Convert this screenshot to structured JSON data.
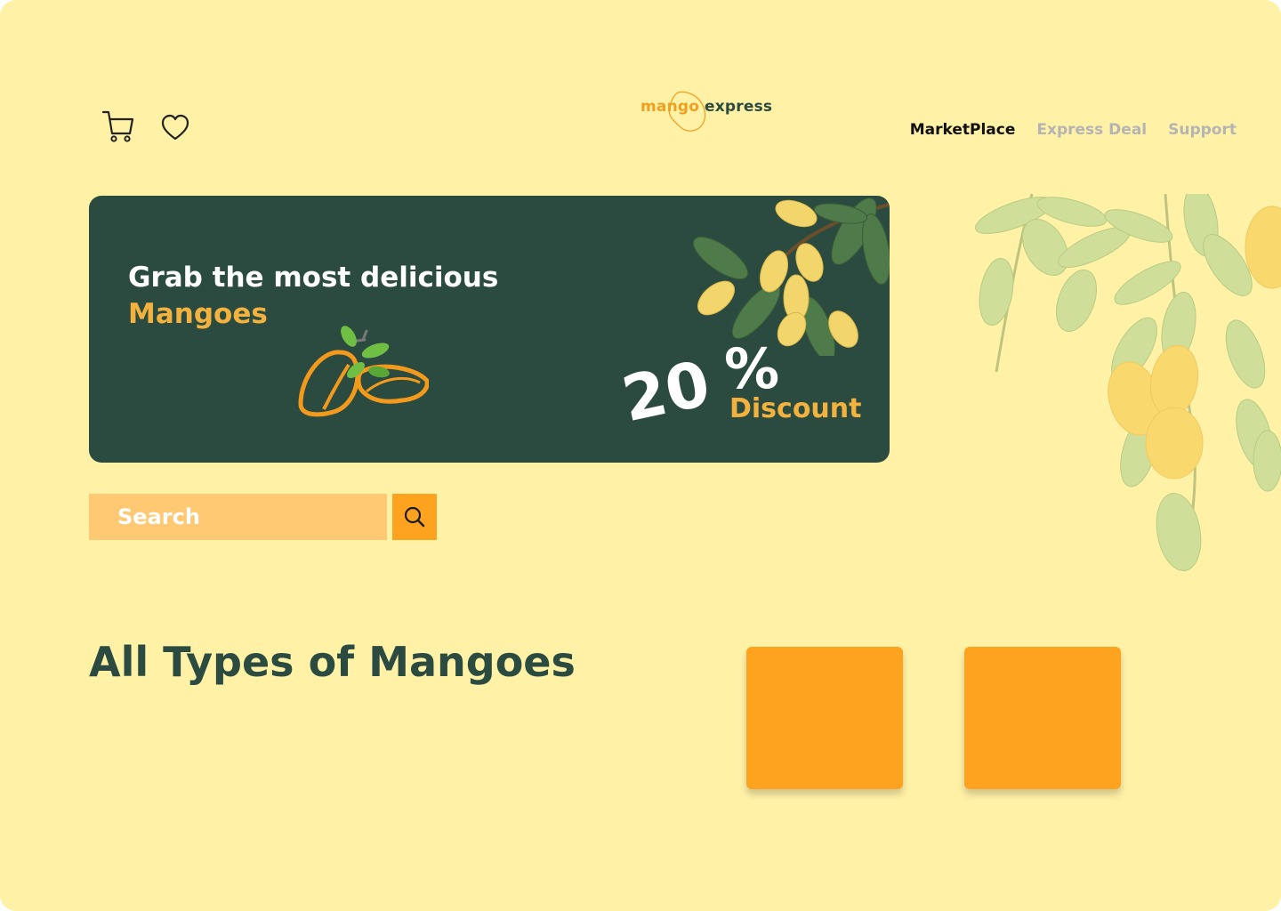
{
  "header": {
    "logo": {
      "word1": "mango",
      "word2": "express"
    },
    "nav": [
      {
        "label": "MarketPlace",
        "active": true
      },
      {
        "label": "Express Deal",
        "active": false
      },
      {
        "label": "Support",
        "active": false
      }
    ],
    "icons": [
      "cart-icon",
      "heart-icon"
    ]
  },
  "banner": {
    "title": "Grab the most delicious",
    "subtitle": "Mangoes",
    "percent_value": "20",
    "percent_sign": "%",
    "discount_label": "Discount"
  },
  "search": {
    "placeholder": "Search",
    "icon": "search-icon"
  },
  "section": {
    "title": "All Types of Mangoes",
    "cards": [
      {
        "color": "#fda31f"
      },
      {
        "color": "#fda31f"
      }
    ]
  },
  "colors": {
    "background": "#fff1a6",
    "primary_dark": "#2c4b40",
    "accent_orange": "#fda31f",
    "accent_yellow": "#f2b23d",
    "search_bg": "#ffc873"
  }
}
